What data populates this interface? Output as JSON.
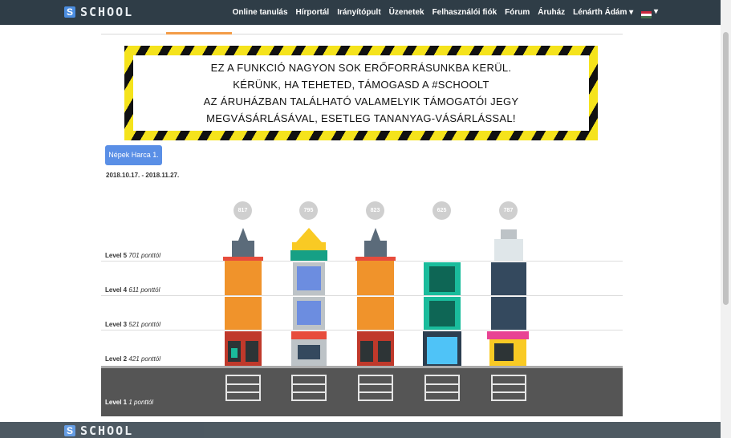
{
  "header": {
    "logo_mark": "S",
    "logo_text": "SCHOOL",
    "nav": [
      "Online tanulás",
      "Hírportál",
      "Irányítópult",
      "Üzenetek",
      "Felhasználói fiók",
      "Fórum",
      "Áruház",
      "Lénárth Ádám ▾"
    ],
    "flag_caret": "▾"
  },
  "banner": {
    "lines": [
      "EZ A FUNKCIÓ NAGYON SOK ERŐFORRÁSUNKBA KERÜL.",
      "KÉRÜNK, HA TEHETED, TÁMOGASD A #SCHOOLT",
      "AZ ÁRUHÁZBAN TALÁLHATÓ VALAMELYIK TÁMOGATÓI JEGY",
      "MEGVÁSÁRLÁSÁVAL, ESETLEG TANANYAG-VÁSÁRLÁSSAL!"
    ]
  },
  "competition": {
    "button_label": "Népek Harca 1.",
    "dates": "2018.10.17. - 2018.11.27."
  },
  "scores": [
    "817",
    "795",
    "823",
    "625",
    "787"
  ],
  "levels": [
    {
      "name": "Level 5",
      "threshold": "701 ponttól"
    },
    {
      "name": "Level 4",
      "threshold": "611 ponttól"
    },
    {
      "name": "Level 3",
      "threshold": "521 ponttól"
    },
    {
      "name": "Level 2",
      "threshold": "421 ponttól"
    },
    {
      "name": "Level 1",
      "threshold": "1 ponttól"
    }
  ],
  "colors": {
    "nav_bg": "#2f3d47",
    "accent": "#f39c47",
    "button": "#5a8fe6",
    "hazard_yellow": "#f5e31c"
  }
}
